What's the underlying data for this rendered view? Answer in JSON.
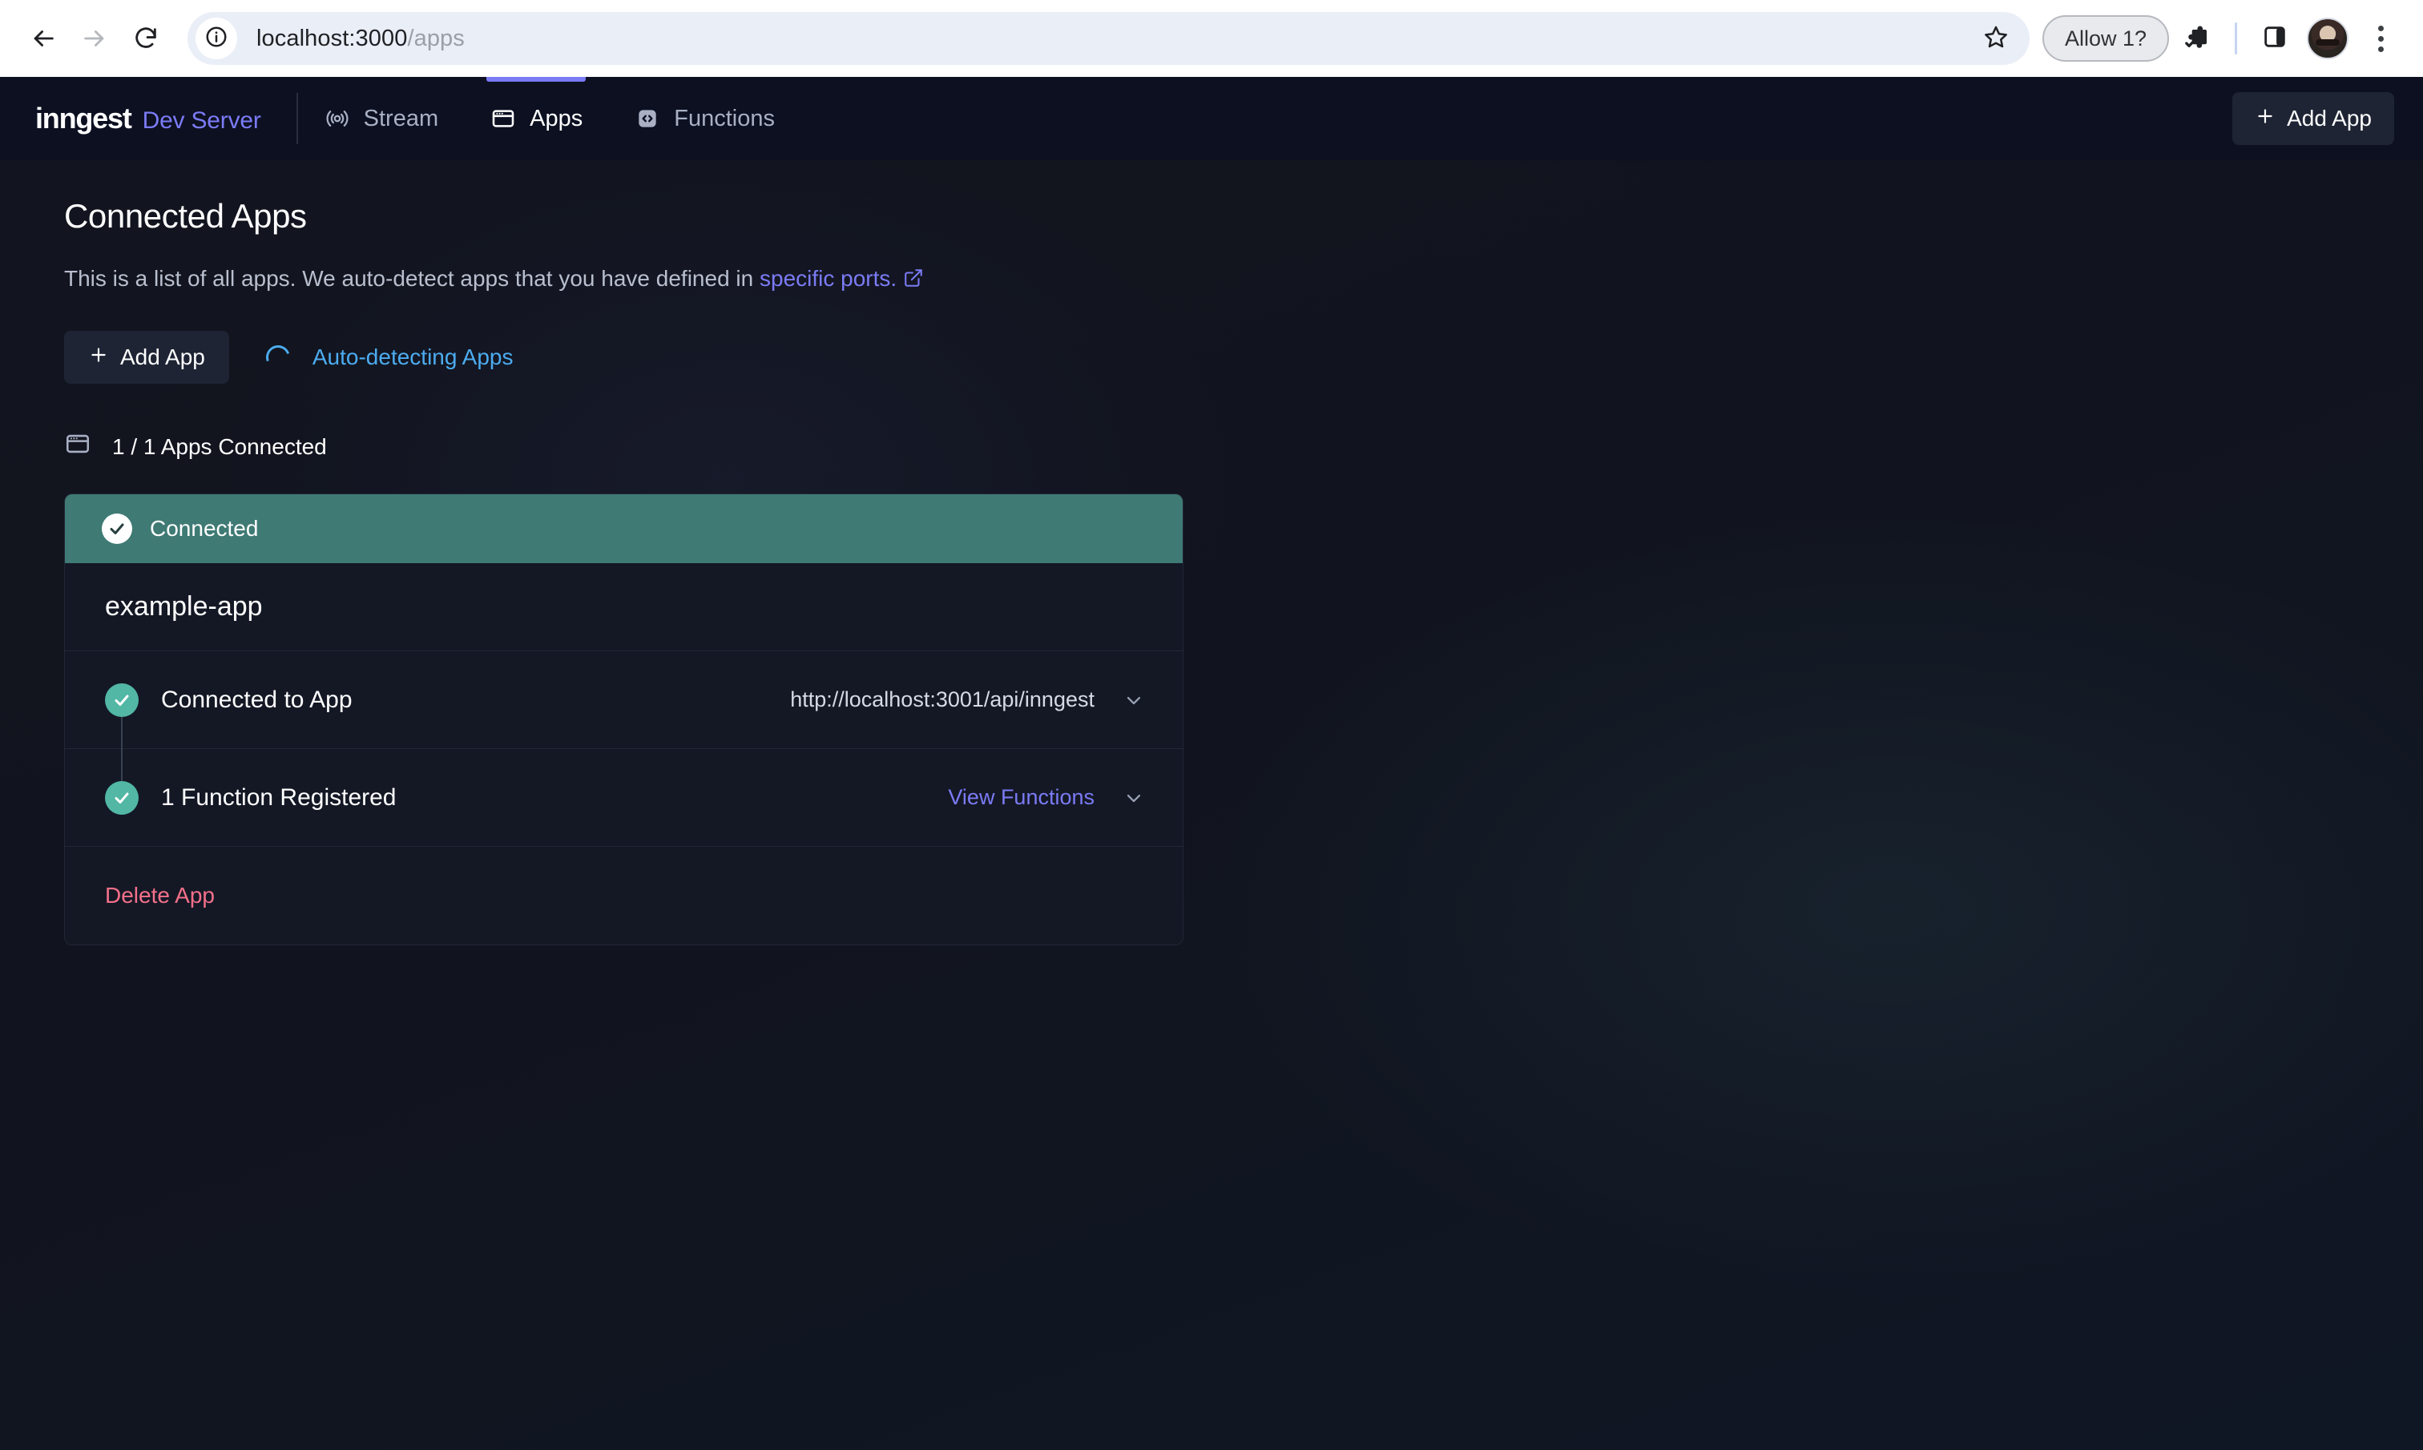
{
  "browser": {
    "back_icon": "arrow-left-icon",
    "forward_icon": "arrow-right-icon",
    "reload_icon": "reload-icon",
    "site_info_icon": "info-circle-icon",
    "url_host": "localhost:3000",
    "url_path": "/apps",
    "url_full": "localhost:3000/apps",
    "bookmark_icon": "star-icon",
    "permission_label": "Allow 1?",
    "extensions_icon": "extensions-puzzle-icon",
    "side_panel_icon": "side-panel-icon",
    "profile_icon": "avatar",
    "menu_icon": "kebab-menu-icon"
  },
  "nav": {
    "brand_mark": "inngest",
    "brand_sub": "Dev Server",
    "tabs": [
      {
        "label": "Stream",
        "icon": "broadcast-icon",
        "active": false
      },
      {
        "label": "Apps",
        "icon": "app-window-icon",
        "active": true
      },
      {
        "label": "Functions",
        "icon": "code-brackets-icon",
        "active": false
      }
    ],
    "add_app_label": "Add App",
    "add_app_icon": "plus-icon"
  },
  "main": {
    "title": "Connected Apps",
    "description_prefix": "This is a list of all apps. We auto-detect apps that you have defined in ",
    "description_link": "specific ports.",
    "description_link_icon": "external-link-icon",
    "add_app_label": "Add App",
    "add_app_icon": "plus-icon",
    "autodetect_label": "Auto-detecting Apps",
    "autodetect_icon": "spinner-icon",
    "count_icon": "app-window-icon",
    "count_label": "1 / 1 Apps Connected"
  },
  "app_card": {
    "status_label": "Connected",
    "status_icon": "check-circle-icon",
    "name": "example-app",
    "rows": [
      {
        "label": "Connected to App",
        "icon": "check-circle-icon",
        "value": "http://localhost:3001/api/inngest",
        "link": "",
        "chevron": "chevron-down-icon"
      },
      {
        "label": "1 Function Registered",
        "icon": "check-circle-icon",
        "value": "",
        "link": "View Functions",
        "chevron": "chevron-down-icon"
      }
    ],
    "delete_label": "Delete App"
  },
  "colors": {
    "accent": "#7b7bf5",
    "status_banner": "#3f7a74",
    "status_dot": "#52b7a5",
    "danger": "#f4708a",
    "info": "#4cacf0",
    "page_bg": "#12151f"
  }
}
